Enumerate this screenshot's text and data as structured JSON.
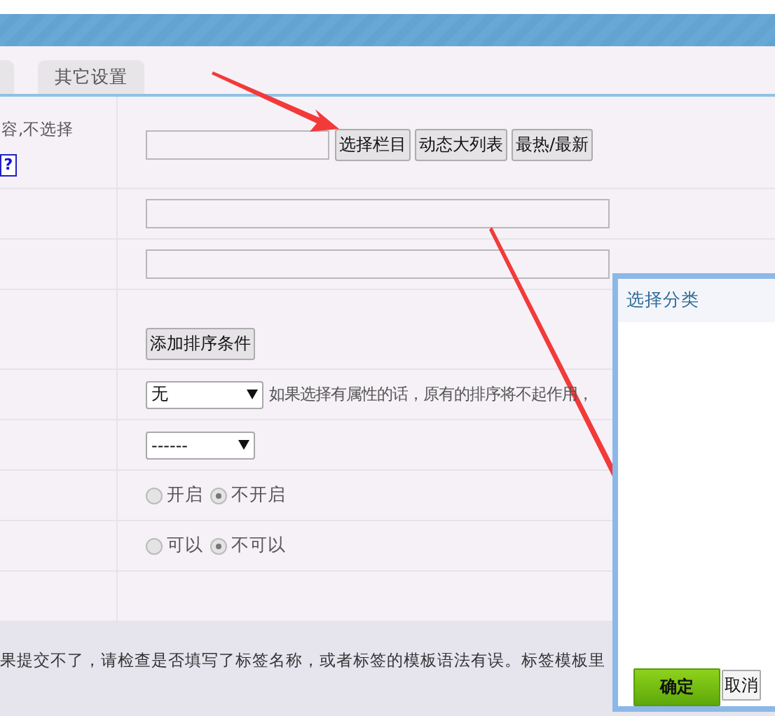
{
  "tabs": [
    {
      "label": "其它设置",
      "selected": false
    }
  ],
  "rows": [
    {
      "kind": "category",
      "label": "容,不选择",
      "help": "?",
      "buttons": [
        "选择栏目",
        "动态大列表",
        "最热/最新"
      ]
    },
    {
      "kind": "text"
    },
    {
      "kind": "text"
    },
    {
      "kind": "button",
      "button": "添加排序条件"
    },
    {
      "kind": "select",
      "value": "无",
      "note": "如果选择有属性的话，原有的排序将不起作用，"
    },
    {
      "kind": "select",
      "value": "------"
    },
    {
      "kind": "radio",
      "options": [
        {
          "label": "开启",
          "selected": false
        },
        {
          "label": "不开启",
          "selected": true
        }
      ]
    },
    {
      "kind": "radio",
      "options": [
        {
          "label": "可以",
          "selected": false
        },
        {
          "label": "不可以",
          "selected": true
        }
      ]
    },
    {
      "kind": "empty"
    }
  ],
  "footer": "果提交不了，请检查是否填写了标签名称，或者标签的模板语法有误。标签模板里",
  "dialog": {
    "title": "选择分类",
    "buttons": [
      {
        "label": "确定",
        "kind": "primary"
      },
      {
        "label": "取消",
        "kind": "plain"
      }
    ]
  }
}
